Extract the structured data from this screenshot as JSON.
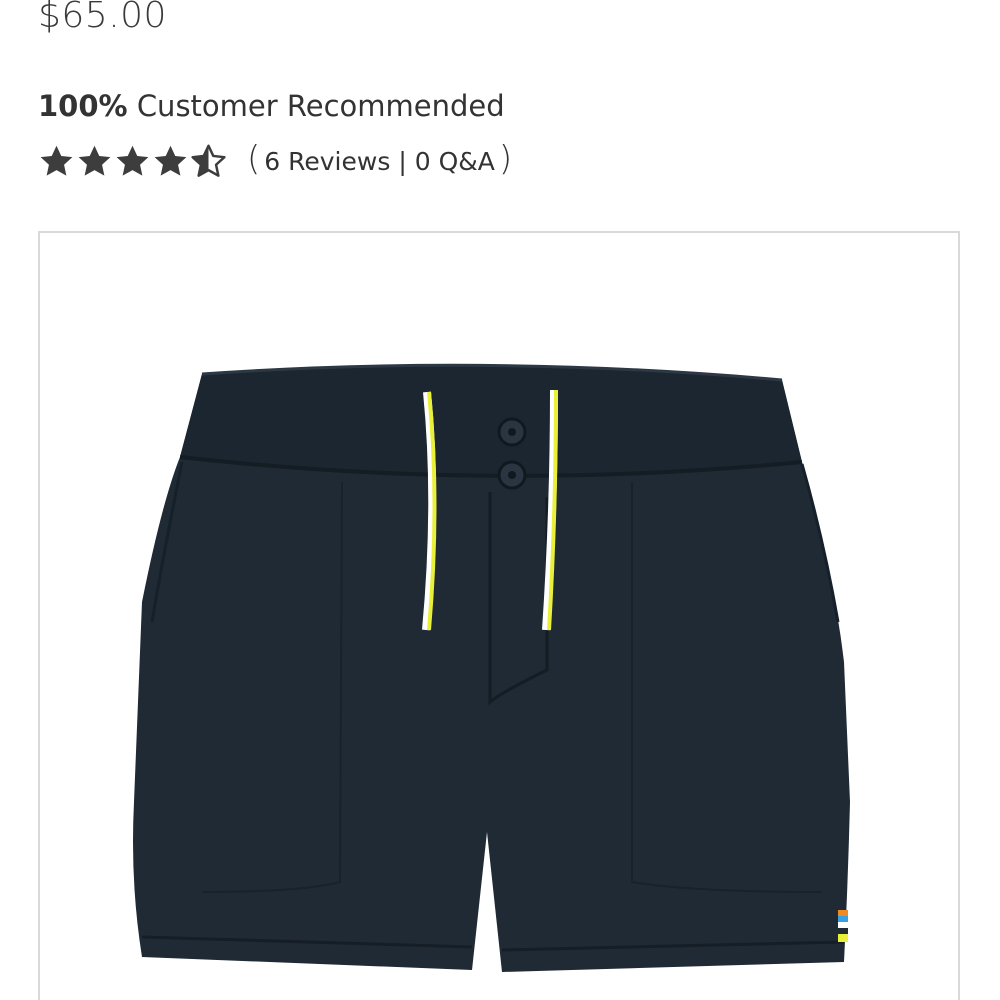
{
  "product": {
    "price": "$65.00",
    "recommendation": {
      "percent": "100%",
      "label": "Customer Recommended"
    },
    "rating": {
      "value": 4.5,
      "max": 5,
      "reviews_label": "6 Reviews",
      "qa_label": "0 Q&A",
      "separator": "|"
    },
    "image": {
      "icon": "shorts-product-image",
      "colors": {
        "fabric": "#1f2a35",
        "drawcord_yellow": "#e8f03a",
        "drawcord_white": "#ffffff",
        "frame_border": "#d9d9d9"
      }
    }
  },
  "colors": {
    "star": "#3d3d3d",
    "text": "#333333"
  }
}
